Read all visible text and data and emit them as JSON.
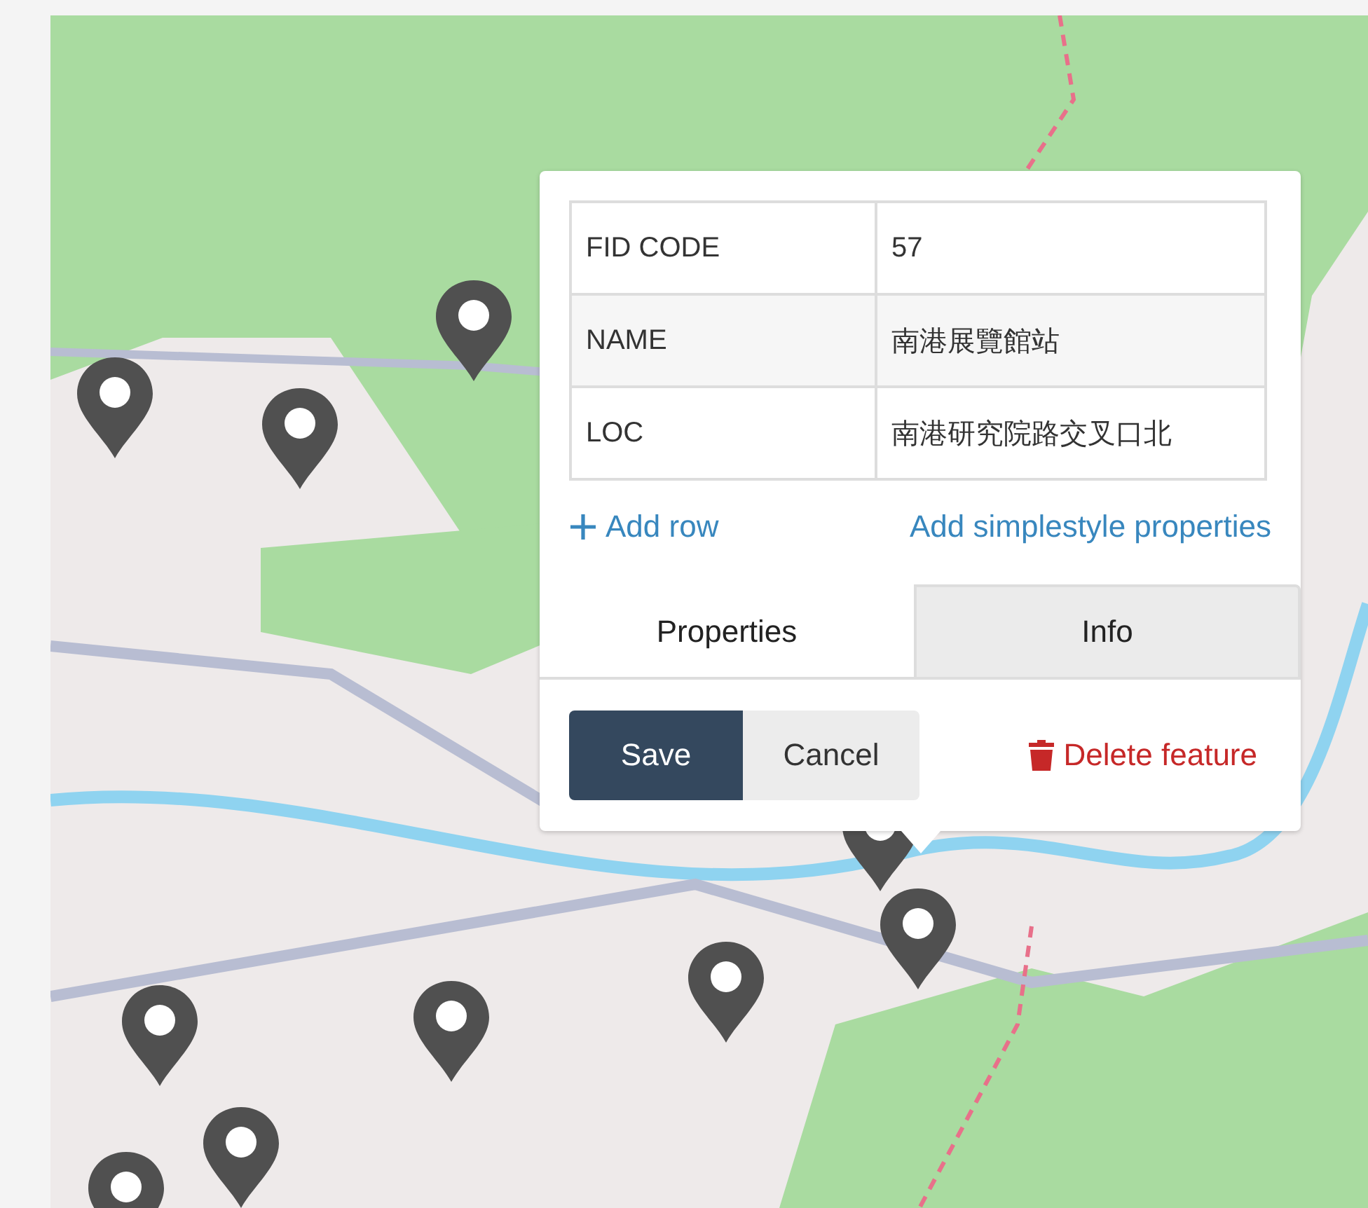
{
  "popup": {
    "properties": [
      {
        "key": "FID CODE",
        "value": "57"
      },
      {
        "key": "NAME",
        "value": "南港展覽館站"
      },
      {
        "key": "LOC",
        "value": "南港研究院路交叉口北"
      }
    ],
    "add_row": "Add row",
    "add_simplestyle": "Add simplestyle properties",
    "tabs": [
      {
        "label": "Properties",
        "selected": true
      },
      {
        "label": "Info",
        "selected": false
      }
    ],
    "save": "Save",
    "cancel": "Cancel",
    "delete": "Delete feature"
  }
}
